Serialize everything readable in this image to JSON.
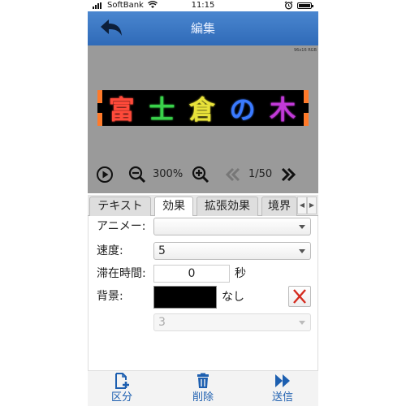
{
  "status_bar": {
    "carrier": "SoftBank",
    "time": "11:15",
    "battery_level": 0.9
  },
  "header": {
    "title": "編集",
    "back_icon": "back-arrow-icon"
  },
  "preview": {
    "resolution_label": "96x16 RGB",
    "led_text": [
      {
        "char": "富",
        "color": "#ff4a3a"
      },
      {
        "char": "士",
        "color": "#39d14a"
      },
      {
        "char": "倉",
        "color": "#e8e23a"
      },
      {
        "char": "の",
        "color": "#3a7aff"
      },
      {
        "char": "木",
        "color": "#c23ad8"
      }
    ],
    "frame_color": "#ff7a2a",
    "zoom": "300%",
    "page": "1/50"
  },
  "tabs": [
    {
      "label": "テキスト",
      "active": false
    },
    {
      "label": "効果",
      "active": true
    },
    {
      "label": "拡張効果",
      "active": false
    },
    {
      "label": "境界",
      "active": false
    }
  ],
  "form": {
    "animation_label": "アニメー:",
    "animation_value": "",
    "speed_label": "速度:",
    "speed_value": "5",
    "dwell_label": "滞在時間:",
    "dwell_value": "0",
    "dwell_unit": "秒",
    "background_label": "背景:",
    "background_color": "#000000",
    "background_none": "なし",
    "disabled_select_value": "3"
  },
  "bottom_bar": [
    {
      "label": "区分",
      "icon": "add-file-icon"
    },
    {
      "label": "削除",
      "icon": "trash-icon"
    },
    {
      "label": "送信",
      "icon": "send-icon"
    }
  ],
  "colors": {
    "accent": "#1d5fb0",
    "header": "#3a78c4",
    "preview_bg": "#9a9a9a"
  }
}
